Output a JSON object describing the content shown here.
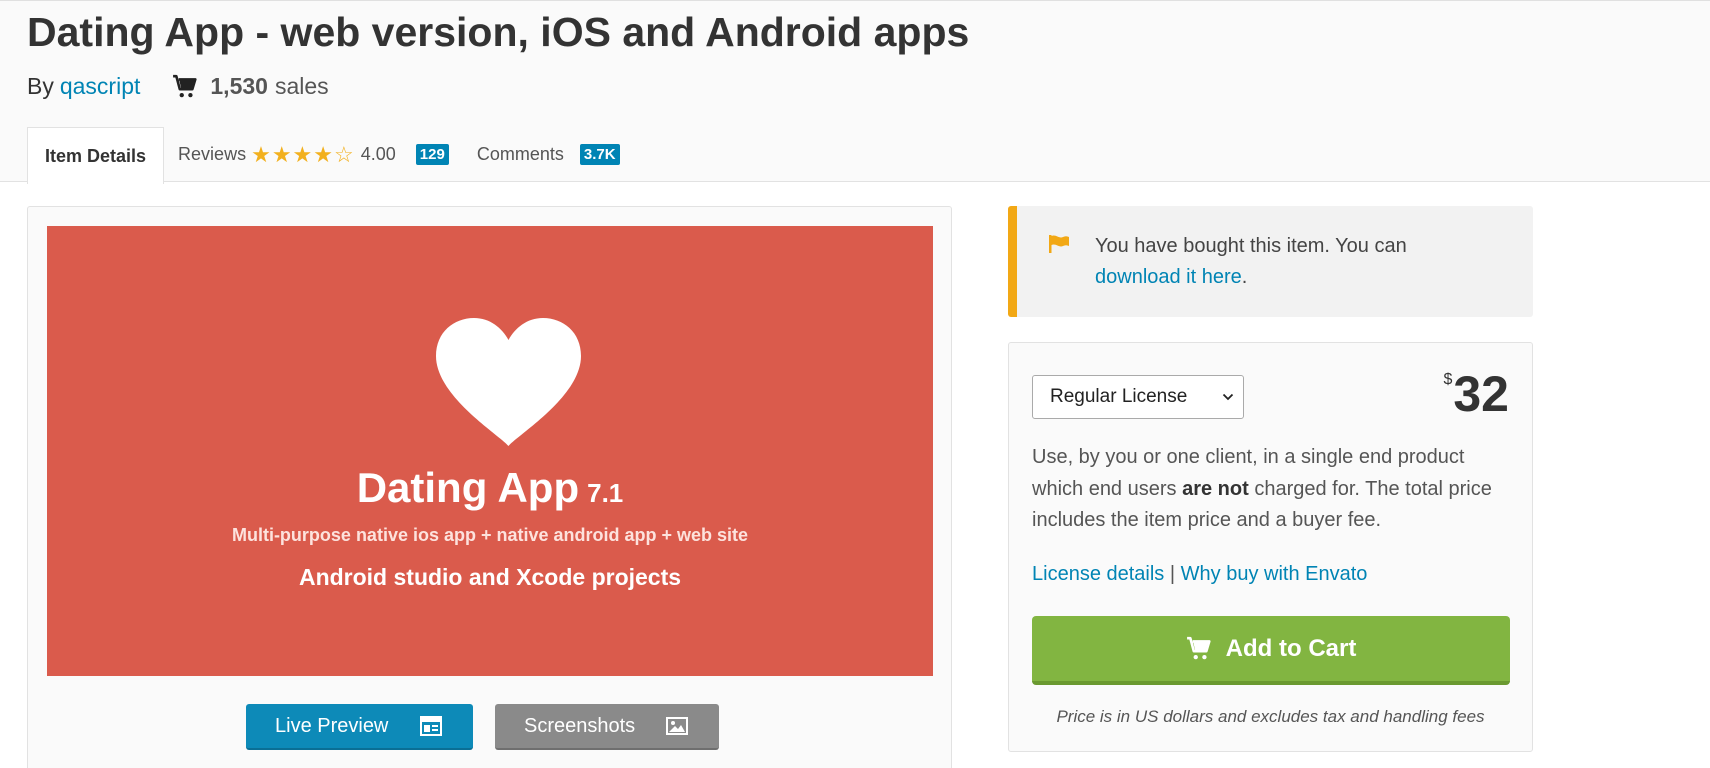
{
  "header": {
    "title": "Dating App - web version, iOS and Android apps",
    "by_label": "By",
    "author": "qascript",
    "sales_count": "1,530",
    "sales_label": "sales"
  },
  "tabs": {
    "item_details": "Item Details",
    "reviews_label": "Reviews",
    "rating": "4.00",
    "rating_value": 4,
    "rating_max": 5,
    "reviews_count": "129",
    "comments_label": "Comments",
    "comments_count": "3.7K"
  },
  "preview": {
    "title": "Dating App",
    "version": "7.1",
    "subtitle": "Multi-purpose native ios app + native android app + web site",
    "subtitle2": "Android studio and Xcode projects",
    "live_preview_label": "Live Preview",
    "screenshots_label": "Screenshots"
  },
  "notice": {
    "text": "You have bought this item. You can",
    "link": "download it here",
    "suffix": "."
  },
  "purchase": {
    "license_selected": "Regular License",
    "currency": "$",
    "price": "32",
    "desc_pre": "Use, by you or one client, in a single end product which end users ",
    "desc_bold": "are not",
    "desc_post": " charged for. The total price includes the item price and a buyer fee.",
    "license_details": "License details",
    "separator": "|",
    "why_buy": "Why buy with Envato",
    "add_to_cart": "Add to Cart",
    "fine_print": "Price is in US dollars and excludes tax and handling fees"
  },
  "colors": {
    "link": "#0084b4",
    "hero_bg": "#da5b4c",
    "cart_green": "#82b541",
    "notice_accent": "#f2a815",
    "star": "#f2b01e"
  },
  "icons": {
    "sales": "shopping-cart-icon",
    "notice": "flag-icon",
    "live_preview": "preview-layout-icon",
    "screenshots": "image-icon",
    "add_to_cart": "shopping-cart-icon",
    "select": "chevron-down-icon",
    "hero": "heart-icon"
  }
}
